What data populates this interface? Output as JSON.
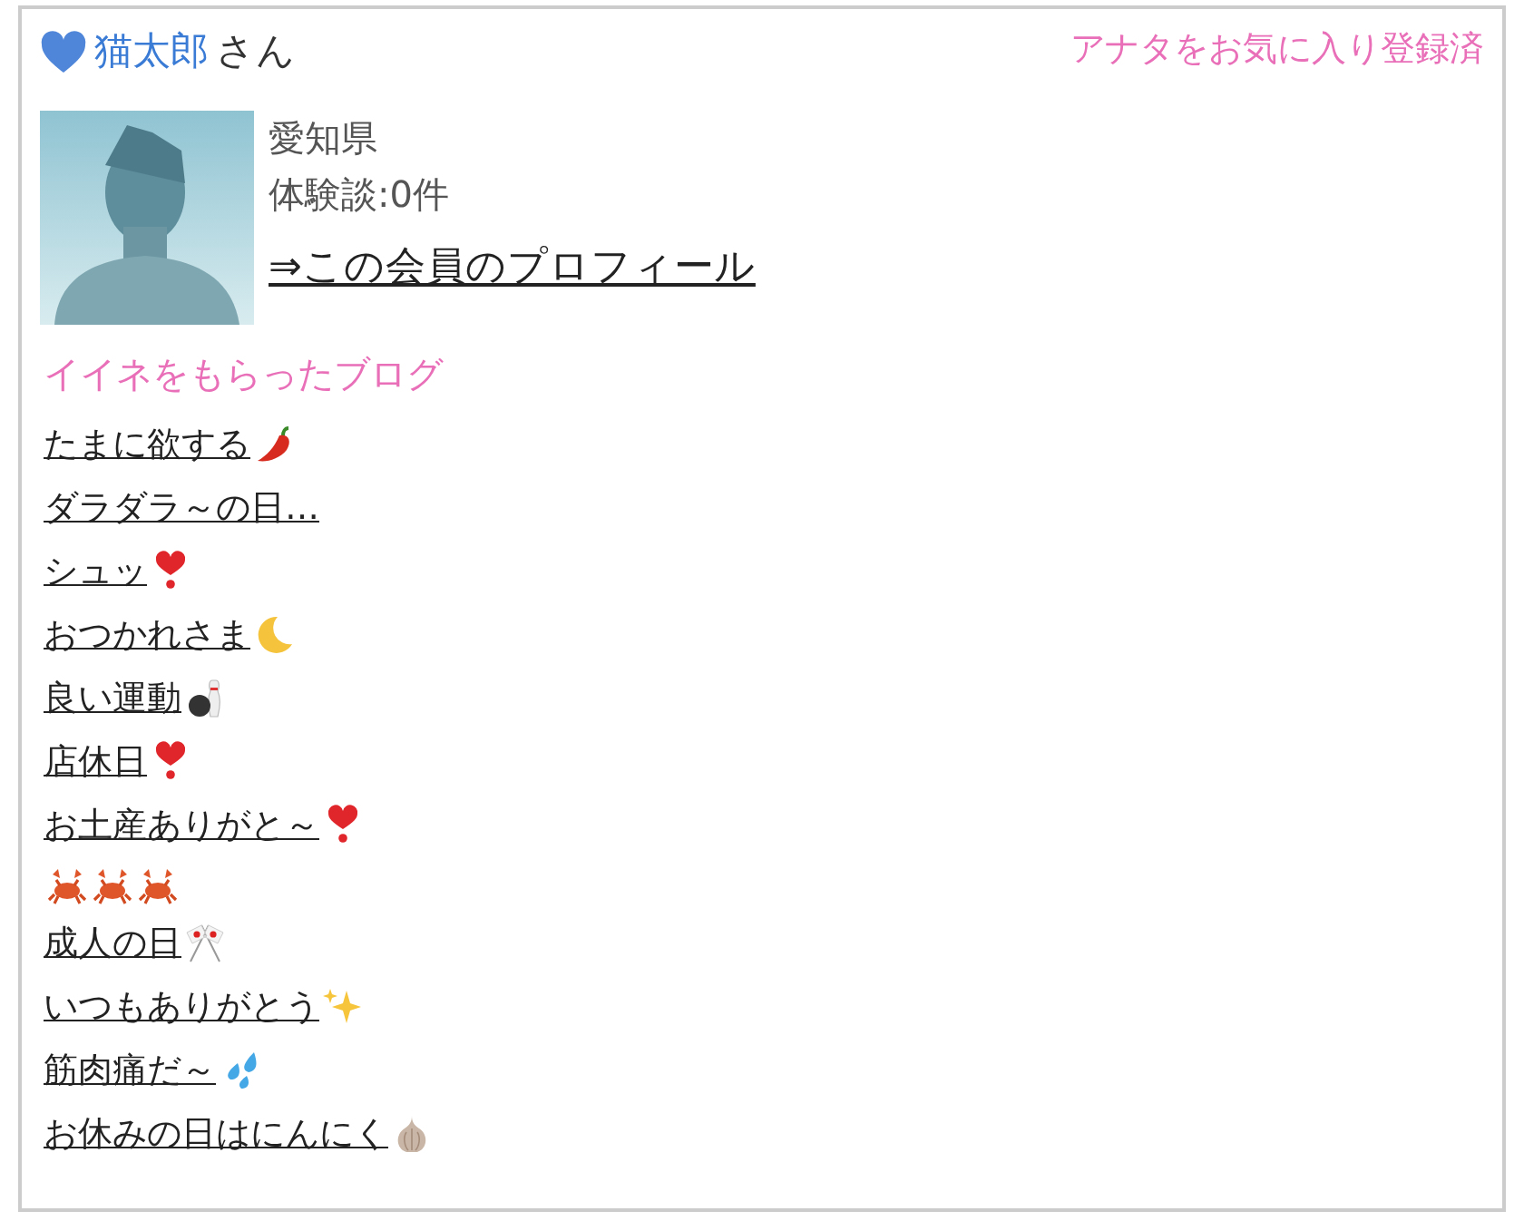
{
  "member": {
    "name": "猫太郎",
    "suffix": "さん",
    "favorite_status": "アナタをお気に入り登録済",
    "region": "愛知県",
    "experiences": "体験談:0件",
    "profile_link": "⇒この会員のプロフィール"
  },
  "liked_blogs": {
    "heading": "イイネをもらったブログ",
    "items": [
      {
        "title": "たまに欲する",
        "icons": [
          {
            "kind": "chili"
          }
        ]
      },
      {
        "title": "ダラダラ～の日…"
      },
      {
        "title": "シュッ",
        "icons": [
          {
            "kind": "heart-exclamation"
          }
        ]
      },
      {
        "title": "おつかれさま",
        "icons": [
          {
            "kind": "moon"
          }
        ]
      },
      {
        "title": "良い運動",
        "icons": [
          {
            "kind": "bowling"
          }
        ]
      },
      {
        "title": "店休日",
        "icons": [
          {
            "kind": "heart-exclamation"
          }
        ]
      },
      {
        "title": "お土産ありがと～",
        "icons": [
          {
            "kind": "heart-exclamation"
          }
        ]
      },
      {
        "icons": [
          {
            "kind": "crab"
          },
          {
            "kind": "crab"
          },
          {
            "kind": "crab"
          }
        ]
      },
      {
        "title": "成人の日",
        "icons": [
          {
            "kind": "flags"
          }
        ]
      },
      {
        "title": "いつもありがとう",
        "icons": [
          {
            "kind": "sparkles"
          }
        ]
      },
      {
        "title": "筋肉痛だ～",
        "icons": [
          {
            "kind": "droplets"
          }
        ]
      },
      {
        "title": "お休みの日はにんにく",
        "icons": [
          {
            "kind": "garlic"
          }
        ]
      }
    ]
  }
}
